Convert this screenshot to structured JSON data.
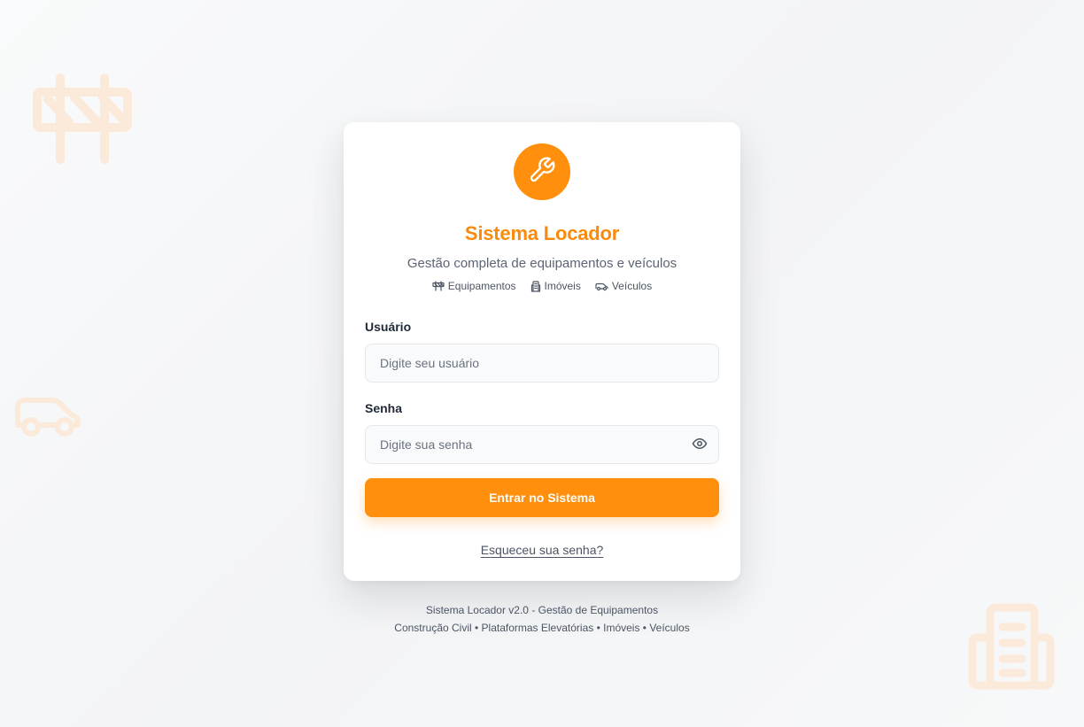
{
  "brand": {
    "title": "Sistema Locador",
    "subtitle": "Gestão completa de equipamentos e veículos",
    "accent_color": "#ff8f0d",
    "logo_icon": "wrench-icon"
  },
  "features": [
    {
      "label": "Equipamentos",
      "icon": "barrier-icon"
    },
    {
      "label": "Imóveis",
      "icon": "building-icon"
    },
    {
      "label": "Veículos",
      "icon": "car-icon"
    }
  ],
  "form": {
    "username": {
      "label": "Usuário",
      "placeholder": "Digite seu usuário",
      "value": ""
    },
    "password": {
      "label": "Senha",
      "placeholder": "Digite sua senha",
      "value": "",
      "toggle_icon": "eye-icon"
    },
    "submit_label": "Entrar no Sistema",
    "forgot_label": "Esqueceu sua senha?"
  },
  "footer": {
    "line1": "Sistema Locador v2.0 - Gestão de Equipamentos",
    "line2": "Construção Civil • Plataformas Elevatórias • Imóveis • Veículos"
  }
}
